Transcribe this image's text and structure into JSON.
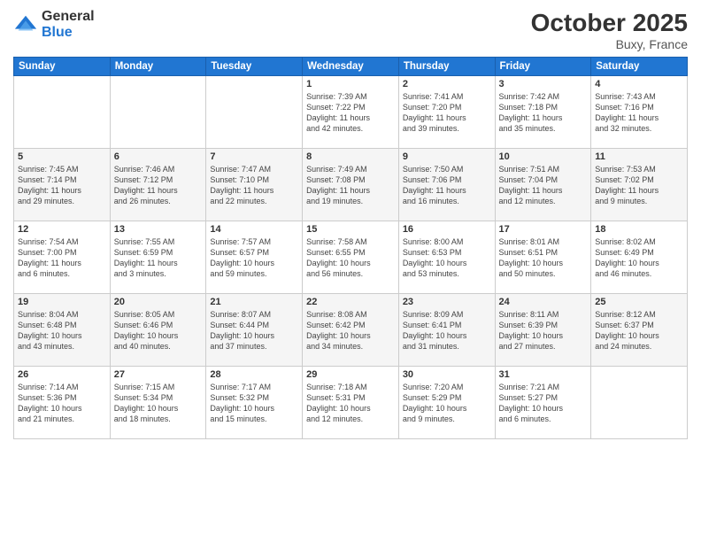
{
  "header": {
    "logo_general": "General",
    "logo_blue": "Blue",
    "title": "October 2025",
    "location": "Buxy, France"
  },
  "days_of_week": [
    "Sunday",
    "Monday",
    "Tuesday",
    "Wednesday",
    "Thursday",
    "Friday",
    "Saturday"
  ],
  "weeks": [
    [
      {
        "day": "",
        "info": ""
      },
      {
        "day": "",
        "info": ""
      },
      {
        "day": "",
        "info": ""
      },
      {
        "day": "1",
        "info": "Sunrise: 7:39 AM\nSunset: 7:22 PM\nDaylight: 11 hours\nand 42 minutes."
      },
      {
        "day": "2",
        "info": "Sunrise: 7:41 AM\nSunset: 7:20 PM\nDaylight: 11 hours\nand 39 minutes."
      },
      {
        "day": "3",
        "info": "Sunrise: 7:42 AM\nSunset: 7:18 PM\nDaylight: 11 hours\nand 35 minutes."
      },
      {
        "day": "4",
        "info": "Sunrise: 7:43 AM\nSunset: 7:16 PM\nDaylight: 11 hours\nand 32 minutes."
      }
    ],
    [
      {
        "day": "5",
        "info": "Sunrise: 7:45 AM\nSunset: 7:14 PM\nDaylight: 11 hours\nand 29 minutes."
      },
      {
        "day": "6",
        "info": "Sunrise: 7:46 AM\nSunset: 7:12 PM\nDaylight: 11 hours\nand 26 minutes."
      },
      {
        "day": "7",
        "info": "Sunrise: 7:47 AM\nSunset: 7:10 PM\nDaylight: 11 hours\nand 22 minutes."
      },
      {
        "day": "8",
        "info": "Sunrise: 7:49 AM\nSunset: 7:08 PM\nDaylight: 11 hours\nand 19 minutes."
      },
      {
        "day": "9",
        "info": "Sunrise: 7:50 AM\nSunset: 7:06 PM\nDaylight: 11 hours\nand 16 minutes."
      },
      {
        "day": "10",
        "info": "Sunrise: 7:51 AM\nSunset: 7:04 PM\nDaylight: 11 hours\nand 12 minutes."
      },
      {
        "day": "11",
        "info": "Sunrise: 7:53 AM\nSunset: 7:02 PM\nDaylight: 11 hours\nand 9 minutes."
      }
    ],
    [
      {
        "day": "12",
        "info": "Sunrise: 7:54 AM\nSunset: 7:00 PM\nDaylight: 11 hours\nand 6 minutes."
      },
      {
        "day": "13",
        "info": "Sunrise: 7:55 AM\nSunset: 6:59 PM\nDaylight: 11 hours\nand 3 minutes."
      },
      {
        "day": "14",
        "info": "Sunrise: 7:57 AM\nSunset: 6:57 PM\nDaylight: 10 hours\nand 59 minutes."
      },
      {
        "day": "15",
        "info": "Sunrise: 7:58 AM\nSunset: 6:55 PM\nDaylight: 10 hours\nand 56 minutes."
      },
      {
        "day": "16",
        "info": "Sunrise: 8:00 AM\nSunset: 6:53 PM\nDaylight: 10 hours\nand 53 minutes."
      },
      {
        "day": "17",
        "info": "Sunrise: 8:01 AM\nSunset: 6:51 PM\nDaylight: 10 hours\nand 50 minutes."
      },
      {
        "day": "18",
        "info": "Sunrise: 8:02 AM\nSunset: 6:49 PM\nDaylight: 10 hours\nand 46 minutes."
      }
    ],
    [
      {
        "day": "19",
        "info": "Sunrise: 8:04 AM\nSunset: 6:48 PM\nDaylight: 10 hours\nand 43 minutes."
      },
      {
        "day": "20",
        "info": "Sunrise: 8:05 AM\nSunset: 6:46 PM\nDaylight: 10 hours\nand 40 minutes."
      },
      {
        "day": "21",
        "info": "Sunrise: 8:07 AM\nSunset: 6:44 PM\nDaylight: 10 hours\nand 37 minutes."
      },
      {
        "day": "22",
        "info": "Sunrise: 8:08 AM\nSunset: 6:42 PM\nDaylight: 10 hours\nand 34 minutes."
      },
      {
        "day": "23",
        "info": "Sunrise: 8:09 AM\nSunset: 6:41 PM\nDaylight: 10 hours\nand 31 minutes."
      },
      {
        "day": "24",
        "info": "Sunrise: 8:11 AM\nSunset: 6:39 PM\nDaylight: 10 hours\nand 27 minutes."
      },
      {
        "day": "25",
        "info": "Sunrise: 8:12 AM\nSunset: 6:37 PM\nDaylight: 10 hours\nand 24 minutes."
      }
    ],
    [
      {
        "day": "26",
        "info": "Sunrise: 7:14 AM\nSunset: 5:36 PM\nDaylight: 10 hours\nand 21 minutes."
      },
      {
        "day": "27",
        "info": "Sunrise: 7:15 AM\nSunset: 5:34 PM\nDaylight: 10 hours\nand 18 minutes."
      },
      {
        "day": "28",
        "info": "Sunrise: 7:17 AM\nSunset: 5:32 PM\nDaylight: 10 hours\nand 15 minutes."
      },
      {
        "day": "29",
        "info": "Sunrise: 7:18 AM\nSunset: 5:31 PM\nDaylight: 10 hours\nand 12 minutes."
      },
      {
        "day": "30",
        "info": "Sunrise: 7:20 AM\nSunset: 5:29 PM\nDaylight: 10 hours\nand 9 minutes."
      },
      {
        "day": "31",
        "info": "Sunrise: 7:21 AM\nSunset: 5:27 PM\nDaylight: 10 hours\nand 6 minutes."
      },
      {
        "day": "",
        "info": ""
      }
    ]
  ]
}
